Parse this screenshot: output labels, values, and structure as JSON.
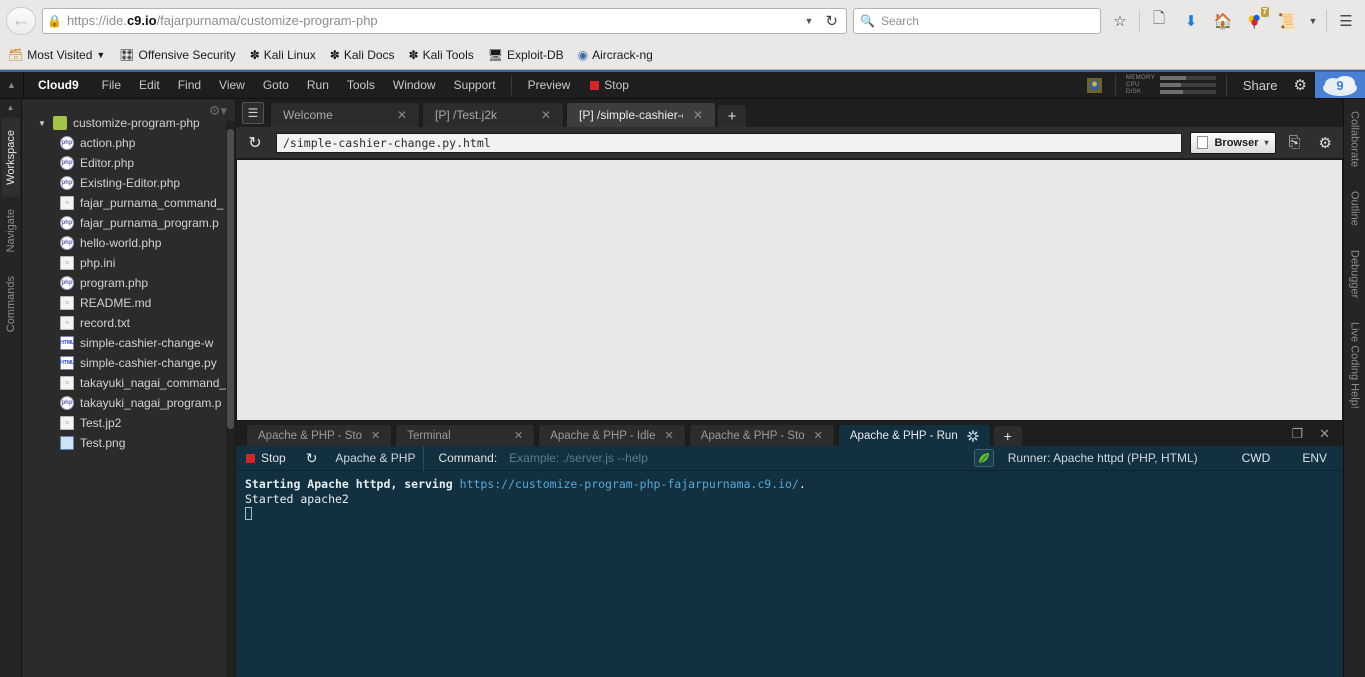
{
  "browser": {
    "url_prefix": "https://ide.",
    "url_bold": "c9.io",
    "url_suffix": "/fajarpurnama/customize-program-php",
    "search_placeholder": "Search",
    "download_badge": "7",
    "back_icon": "back-arrow-icon",
    "lock_icon": "lock-icon",
    "reload_icon": "reload-icon",
    "bookmarks": [
      {
        "label": "Most Visited",
        "icon": "most-visited-icon",
        "caret": "▾"
      },
      {
        "label": "Offensive Security",
        "icon": "offensive-security-icon",
        "caret": ""
      },
      {
        "label": "Kali Linux",
        "icon": "kali-dragon-icon",
        "caret": ""
      },
      {
        "label": "Kali Docs",
        "icon": "kali-dragon-icon",
        "caret": ""
      },
      {
        "label": "Kali Tools",
        "icon": "kali-dragon-icon",
        "caret": ""
      },
      {
        "label": "Exploit-DB",
        "icon": "exploit-db-icon",
        "caret": ""
      },
      {
        "label": "Aircrack-ng",
        "icon": "aircrack-ng-icon",
        "caret": ""
      }
    ]
  },
  "menubar": {
    "collapse_icon": "collapse-caret-icon",
    "brand": "Cloud9",
    "items": [
      "File",
      "Edit",
      "Find",
      "View",
      "Goto",
      "Run",
      "Tools",
      "Window",
      "Support"
    ],
    "preview_label": "Preview",
    "stop_label": "Stop",
    "share_label": "Share",
    "gear_icon": "gear-icon",
    "logo_text": "9",
    "stats": [
      {
        "label": "MEMORY",
        "percent": 46
      },
      {
        "label": "CPU",
        "percent": 38
      },
      {
        "label": "DISK",
        "percent": 42
      }
    ]
  },
  "left_rail": {
    "collapse_icon": "collapse-caret-icon",
    "tabs": [
      {
        "label": "Workspace",
        "active": true
      },
      {
        "label": "Navigate",
        "active": false
      },
      {
        "label": "Commands",
        "active": false
      }
    ]
  },
  "right_rail": {
    "tabs": [
      {
        "label": "Collaborate"
      },
      {
        "label": "Outline"
      },
      {
        "label": "Debugger"
      },
      {
        "label": "Live Coding Help!"
      }
    ]
  },
  "file_tree": {
    "gear_icon": "tree-settings-gear-icon",
    "root": {
      "label": "customize-program-php",
      "icon": "folder-icon",
      "twisty": "▼"
    },
    "files": [
      {
        "label": "action.php",
        "icon": "php-file-icon",
        "type": "php"
      },
      {
        "label": "Editor.php",
        "icon": "php-file-icon",
        "type": "php"
      },
      {
        "label": "Existing-Editor.php",
        "icon": "php-file-icon",
        "type": "php"
      },
      {
        "label": "fajar_purnama_command_",
        "icon": "text-file-icon",
        "type": "txt"
      },
      {
        "label": "fajar_purnama_program.p",
        "icon": "php-file-icon",
        "type": "php"
      },
      {
        "label": "hello-world.php",
        "icon": "php-file-icon",
        "type": "php"
      },
      {
        "label": "php.ini",
        "icon": "text-file-icon",
        "type": "txt"
      },
      {
        "label": "program.php",
        "icon": "php-file-icon",
        "type": "php"
      },
      {
        "label": "README.md",
        "icon": "text-file-icon",
        "type": "txt"
      },
      {
        "label": "record.txt",
        "icon": "text-file-icon",
        "type": "txt"
      },
      {
        "label": "simple-cashier-change-w",
        "icon": "html-file-icon",
        "type": "html"
      },
      {
        "label": "simple-cashier-change.py",
        "icon": "html-file-icon",
        "type": "html"
      },
      {
        "label": "takayuki_nagai_command_",
        "icon": "text-file-icon",
        "type": "txt"
      },
      {
        "label": "takayuki_nagai_program.p",
        "icon": "php-file-icon",
        "type": "php"
      },
      {
        "label": "Test.jp2",
        "icon": "text-file-icon",
        "type": "txt"
      },
      {
        "label": "Test.png",
        "icon": "image-file-icon",
        "type": "img"
      }
    ]
  },
  "editor_tabs": {
    "menu_icon": "tab-list-icon",
    "plus_label": "+",
    "tabs": [
      {
        "label": "Welcome",
        "active": false,
        "truncated": false
      },
      {
        "label": "[P] /Test.j2k",
        "active": false,
        "truncated": false
      },
      {
        "label": "[P] /simple-cashier-c",
        "active": true,
        "truncated": true
      }
    ]
  },
  "preview": {
    "reload_icon": "reload-icon",
    "url_value": "/simple-cashier-change.py.html",
    "mode_label": "Browser",
    "mode_caret": "▾",
    "page_icon": "page-icon",
    "popout_icon": "popout-window-icon",
    "settings_icon": "gear-icon"
  },
  "console": {
    "tabs": [
      {
        "label": "Apache & PHP - Sto",
        "active": false,
        "spinner": false,
        "closable": true
      },
      {
        "label": "Terminal",
        "active": false,
        "spinner": false,
        "closable": true
      },
      {
        "label": "Apache & PHP - Idle",
        "active": false,
        "spinner": false,
        "closable": true
      },
      {
        "label": "Apache & PHP - Sto",
        "active": false,
        "spinner": false,
        "closable": true
      },
      {
        "label": "Apache & PHP - Run",
        "active": true,
        "spinner": true,
        "closable": false
      }
    ],
    "plus_label": "+",
    "maximize_icon": "maximize-panel-icon",
    "close_icon": "close-panel-icon",
    "runner": {
      "stop_label": "Stop",
      "reload_icon": "reload-icon",
      "name": "Apache & PHP",
      "command_label": "Command:",
      "command_placeholder": "Example: ./server.js --help",
      "leaf_icon": "runner-leaf-icon",
      "runner_text": "Runner: Apache httpd (PHP, HTML)",
      "cwd_label": "CWD",
      "env_label": "ENV"
    },
    "output": {
      "line1_bold": "Starting Apache httpd, serving ",
      "line1_link": "https://customize-program-php-fajarpurnama.c9.io/",
      "line1_tail": ".",
      "line2": "Started apache2"
    }
  },
  "colors": {
    "accent_blue": "#3b5fa8",
    "console_bg": "#12303f",
    "link": "#55a8d8",
    "stop_red": "#d4242b",
    "folder_green": "#a5c24a"
  }
}
